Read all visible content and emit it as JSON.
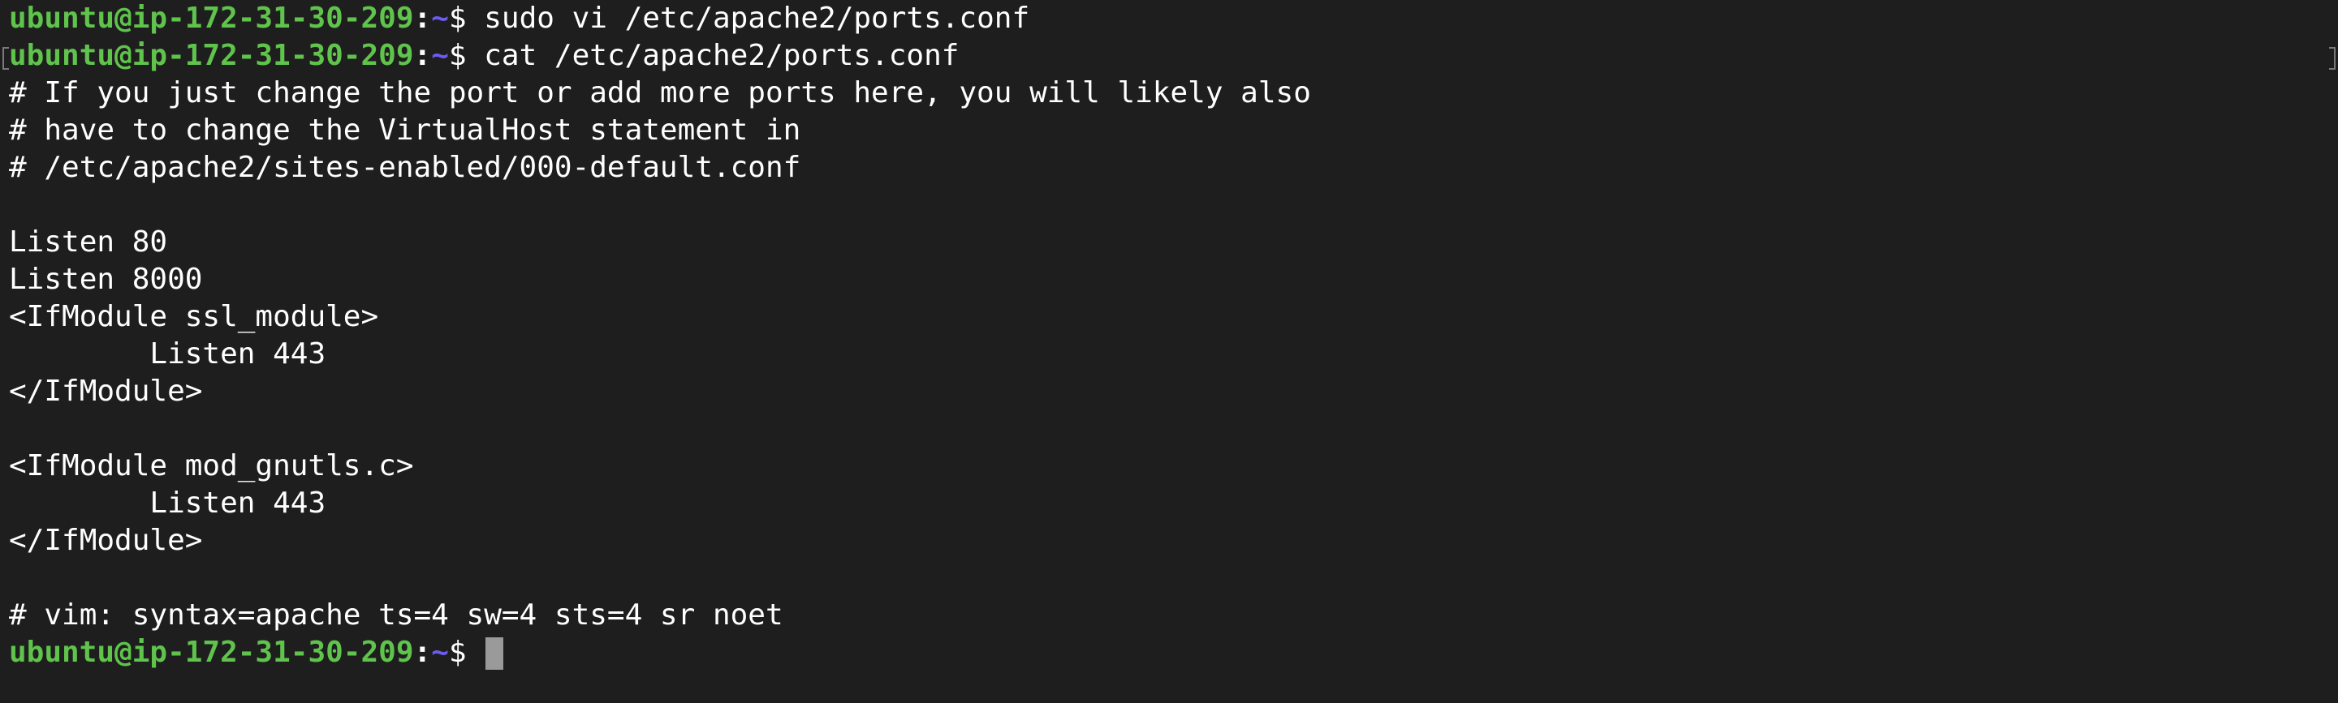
{
  "prompt": {
    "user_host": "ubuntu@ip-172-31-30-209",
    "colon": ":",
    "path": "~",
    "symbol": "$"
  },
  "commands": [
    " sudo vi /etc/apache2/ports.conf",
    " cat /etc/apache2/ports.conf"
  ],
  "output_lines": [
    "# If you just change the port or add more ports here, you will likely also",
    "# have to change the VirtualHost statement in",
    "# /etc/apache2/sites-enabled/000-default.conf",
    "",
    "Listen 80",
    "Listen 8000",
    "<IfModule ssl_module>",
    "        Listen 443",
    "</IfModule>",
    "",
    "<IfModule mod_gnutls.c>",
    "        Listen 443",
    "</IfModule>",
    "",
    "# vim: syntax=apache ts=4 sw=4 sts=4 sr noet"
  ],
  "final_prompt_suffix": " ",
  "colors": {
    "background": "#1e1e1e",
    "user_host": "#5fc34c",
    "path": "#6b5cf0",
    "text": "#ffffff",
    "cursor": "#9a9a9a"
  }
}
